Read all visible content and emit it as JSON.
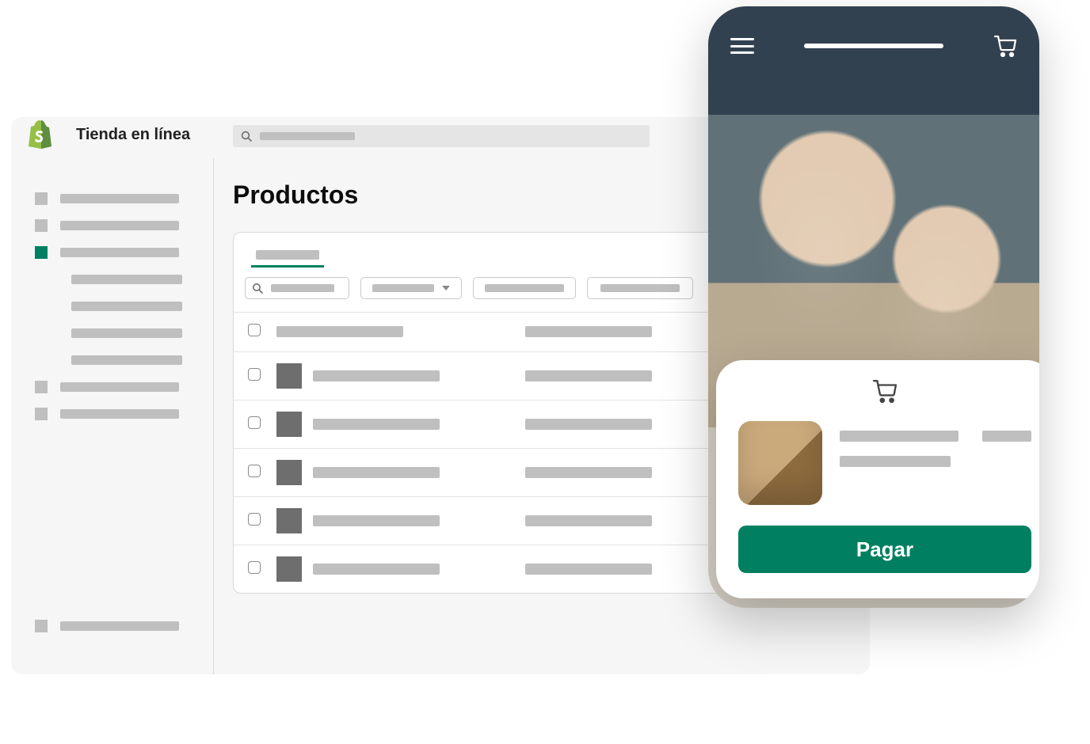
{
  "brand": {
    "title": "Tienda en línea"
  },
  "page": {
    "title": "Productos"
  },
  "checkout": {
    "pay_label": "Pagar"
  }
}
